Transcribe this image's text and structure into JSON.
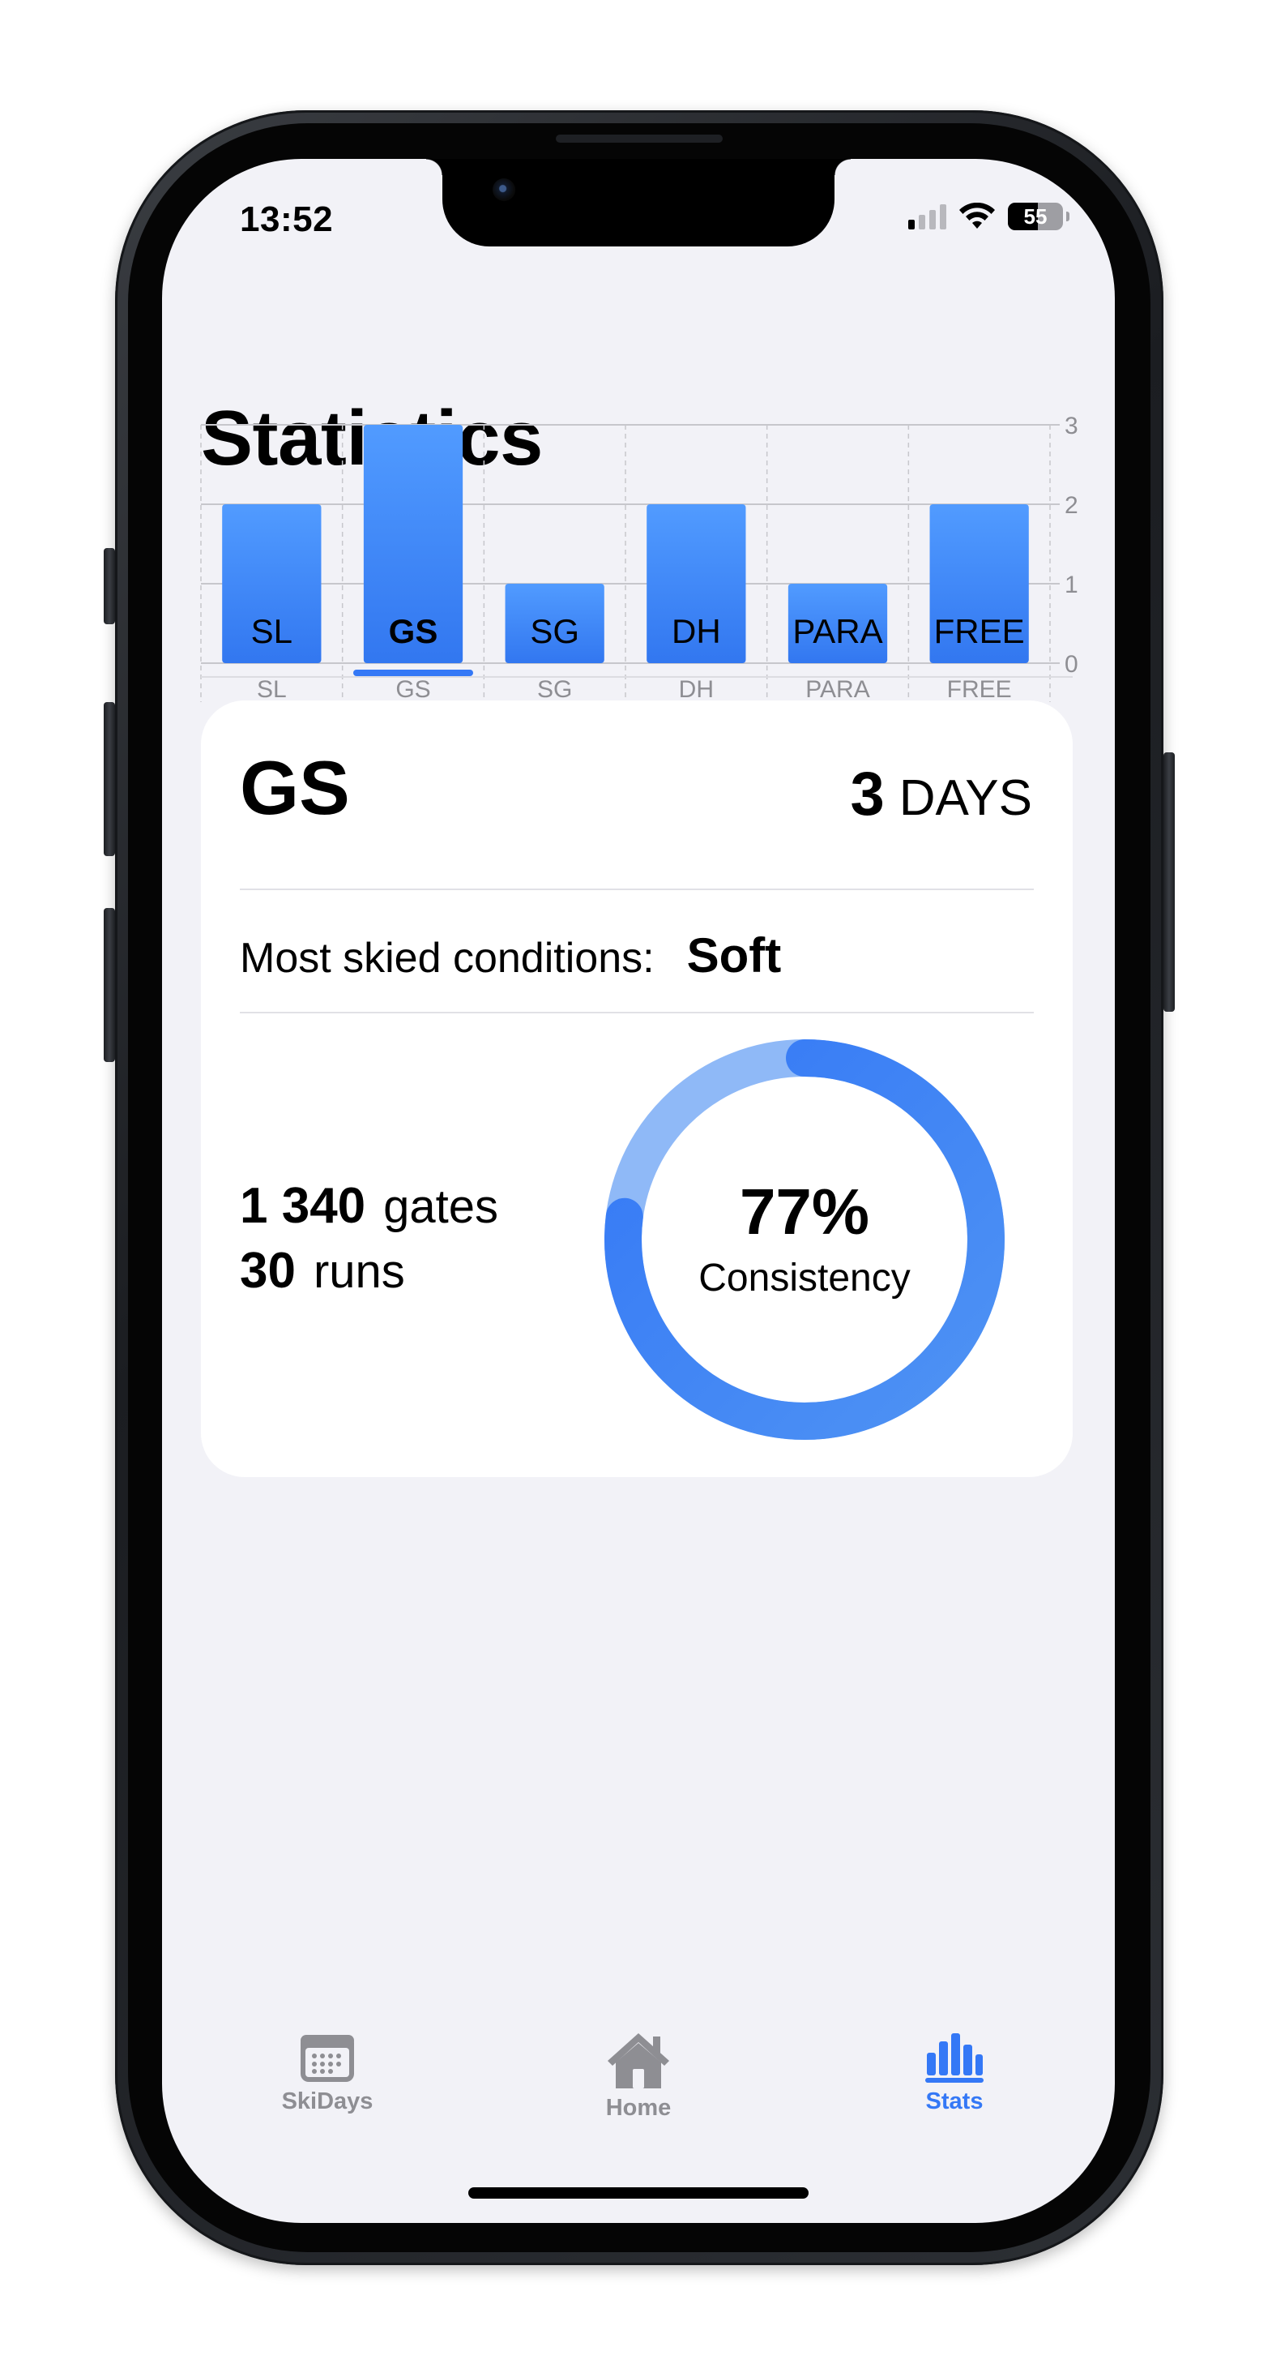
{
  "status_bar": {
    "time": "13:52",
    "battery_level": "55",
    "battery_fraction": 0.55,
    "signal_bars_active": 1
  },
  "page": {
    "title": "Statistics"
  },
  "colors": {
    "accent": "#3478f6",
    "bar_top": "#519bff",
    "bar_bottom": "#3277f0",
    "ring_light": "#8fb9f7",
    "ring_dark": "#3478f6",
    "inactive": "#8e8e93"
  },
  "chart_data": {
    "type": "bar",
    "categories": [
      "SL",
      "GS",
      "SG",
      "DH",
      "PARA",
      "FREE"
    ],
    "values": [
      2,
      3,
      1,
      2,
      1,
      2
    ],
    "ylim": [
      0,
      3
    ],
    "yticks": [
      0,
      1,
      2,
      3
    ],
    "grid": true,
    "yaxis_position": "right"
  },
  "tabs": {
    "items": [
      "SL",
      "GS",
      "SG",
      "DH",
      "PARA",
      "FREE"
    ],
    "selected_index": 1
  },
  "detail": {
    "discipline": "GS",
    "days_count": "3",
    "days_unit": "DAYS",
    "conditions_label": "Most skied conditions:",
    "conditions_value": "Soft",
    "gates_count": "1 340",
    "gates_unit": "gates",
    "runs_count": "30",
    "runs_unit": "runs",
    "consistency_percent": "77%",
    "consistency_label": "Consistency",
    "consistency_fraction": 0.77
  },
  "tabbar": {
    "items": [
      {
        "label": "SkiDays",
        "icon": "calendar-icon",
        "active": false
      },
      {
        "label": "Home",
        "icon": "house-icon",
        "active": false
      },
      {
        "label": "Stats",
        "icon": "chart-icon",
        "active": true
      }
    ]
  }
}
